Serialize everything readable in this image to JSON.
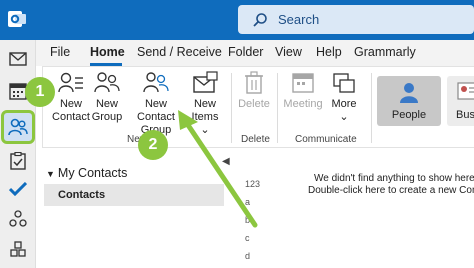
{
  "titlebar": {
    "search_placeholder": "Search",
    "accent": "#0f6cbd"
  },
  "menu_tabs": [
    "File",
    "Home",
    "Send / Receive",
    "Folder",
    "View",
    "Help",
    "Grammarly"
  ],
  "active_tab": "Home",
  "ribbon": {
    "new_contact": [
      "New",
      "Contact"
    ],
    "new_group": [
      "New",
      "Group"
    ],
    "new_contact_group": [
      "New Contact",
      "Group"
    ],
    "new_items": [
      "New",
      "Items ⌄"
    ],
    "new_group_label": "New",
    "delete": "Delete",
    "delete_group_label": "Delete",
    "meeting": "Meeting",
    "more": "More ⌄",
    "communicate_label": "Communicate",
    "people": "People",
    "business": "Busine"
  },
  "folder_pane": {
    "header": "My Contacts",
    "selected_folder": "Contacts"
  },
  "main": {
    "index": [
      "123",
      "a",
      "b",
      "c",
      "d"
    ],
    "empty_line1": "We didn't find anything to show here.",
    "empty_line2": "Double-click here to create a new Contact"
  },
  "callouts": {
    "step1": "1",
    "step2": "2",
    "color": "#8cc63f"
  },
  "icons": {
    "app": "outlook-icon",
    "search": "search-icon",
    "rail": [
      "mail-icon",
      "calendar-icon",
      "people-icon",
      "tasks-icon",
      "checkmark-icon",
      "groups-icon"
    ]
  }
}
